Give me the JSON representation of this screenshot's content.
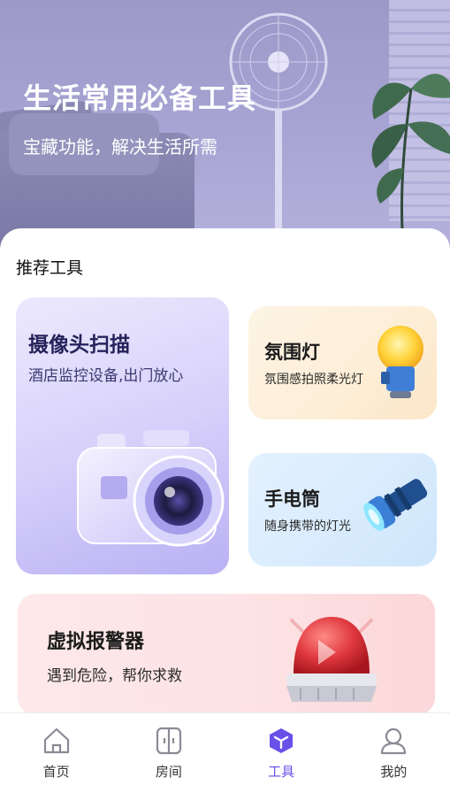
{
  "hero": {
    "title": "生活常用必备工具",
    "subtitle": "宝藏功能，解决生活所需"
  },
  "section": {
    "title": "推荐工具"
  },
  "tools": {
    "camera": {
      "title": "摄像头扫描",
      "desc": "酒店监控设备,出门放心",
      "icon": "camera-icon"
    },
    "lamp": {
      "title": "氛围灯",
      "desc": "氛围感拍照柔光灯",
      "icon": "light-bulb-icon"
    },
    "torch": {
      "title": "手电筒",
      "desc": "随身携带的灯光",
      "icon": "flashlight-icon"
    },
    "alarm": {
      "title": "虚拟报警器",
      "desc": "遇到危险，帮你求救",
      "icon": "alarm-siren-icon"
    }
  },
  "tabbar": {
    "tabs": [
      {
        "label": "首页",
        "icon": "home-icon"
      },
      {
        "label": "房间",
        "icon": "room-icon"
      },
      {
        "label": "工具",
        "icon": "tools-cube-icon"
      },
      {
        "label": "我的",
        "icon": "profile-icon"
      }
    ],
    "active_index": 2
  },
  "colors": {
    "accent": "#6a4fe8",
    "hero_bg": "#a6a2d2",
    "alarm_red": "#e0393f"
  }
}
